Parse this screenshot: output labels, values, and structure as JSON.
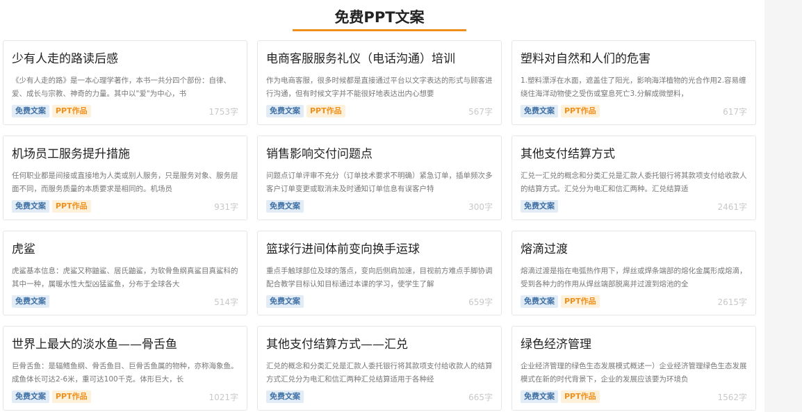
{
  "page": {
    "title": "免费PPT文案"
  },
  "tags": {
    "free": "免费文案",
    "ppt": "PPT作品"
  },
  "colors": {
    "accent": "#f0901c",
    "free_tag_bg": "#e1ecf7",
    "ppt_tag_bg": "#fdf1dc"
  },
  "cards": [
    {
      "title": "少有人走的路读后感",
      "desc": "《少有人走的路》是一本心理学著作，本书一共分四个部份：自律、爱、成长与宗教、神奇的力量。其中以\"爱\"为中心，书",
      "count": "1753字",
      "has_ppt": true
    },
    {
      "title": "电商客服服务礼仪（电话沟通）培训",
      "desc": "作为电商客服，很多时候都是直接通过平台以文字表达的形式与顾客进行沟通，但有时候文字并不能很好地表达出内心想要",
      "count": "567字",
      "has_ppt": true
    },
    {
      "title": "塑料对自然和人们的危害",
      "desc": "1.塑料漂浮在水面，遮盖住了阳光，影响海洋植物的光合作用2.容易缠绕住海洋动物使之受伤或窒息死亡3.分解成微塑料，",
      "count": "617字",
      "has_ppt": true
    },
    {
      "title": "机场员工服务提升措施",
      "desc": "任何职业都是间接或直接地为人类或别人服务，只是服务对象、服务层面不同，而服务质量的本质要求是相同的。机场员",
      "count": "931字",
      "has_ppt": true
    },
    {
      "title": "销售影响交付问题点",
      "desc": "问题点订单评审不充分（订单技术要求不明确）紧急订单，插单频次多客户订单变更或取消未及时通知订单信息有误客户特",
      "count": "300字",
      "has_ppt": false
    },
    {
      "title": "其他支付结算方式",
      "desc": "汇兑一汇兑的概念和分类汇兑是汇款人委托银行将其款项支付给收款人的结算方式。汇兑分为电汇和信汇两种。汇兑结算适",
      "count": "2461字",
      "has_ppt": false
    },
    {
      "title": "虎鲨",
      "desc": "虎鲨基本信息：虎鲨又称鼬鲨、居氏鼬鲨，为软骨鱼纲真鲨目真鲨科的其中一种，属暖水性大型凶猛鲨鱼，分布于全球各大",
      "count": "514字",
      "has_ppt": false
    },
    {
      "title": "篮球行进间体前变向换手运球",
      "desc": "重点手触球部位及球的落点，变向后侧肩加速，目视前方难点手脚协调配合教学目标认知目标通过本课的学习，使学生了解",
      "count": "659字",
      "has_ppt": false
    },
    {
      "title": "熔滴过渡",
      "desc": "熔滴过渡是指在电弧热作用下，焊丝或焊条端部的熔化金属形成熔滴，受到各种力的作用从焊丝端部脱离并过渡到熔池的全",
      "count": "2615字",
      "has_ppt": true
    },
    {
      "title": "世界上最大的淡水鱼——骨舌鱼",
      "desc": "巨骨舌鱼：是辐鳍鱼纲、骨舌鱼目、巨骨舌鱼属的物种，亦称海象鱼。成鱼体长可达2-6米，重可达100千克。体形巨大，长",
      "count": "1021字",
      "has_ppt": true
    },
    {
      "title": "其他支付结算方式——汇兑",
      "desc": "汇兑的概念和分类汇兑是汇款人委托银行将其款项支付给收款人的结算方式汇兑分为电汇和信汇两种汇兑结算适用于各种经",
      "count": "665字",
      "has_ppt": false
    },
    {
      "title": "绿色经济管理",
      "desc": "企业经济管理的绿色生态发展模式概述一）企业经济管理绿色生态发展模式在新的时代背景下，企业的发展应该要为环境负",
      "count": "1562字",
      "has_ppt": true
    }
  ]
}
